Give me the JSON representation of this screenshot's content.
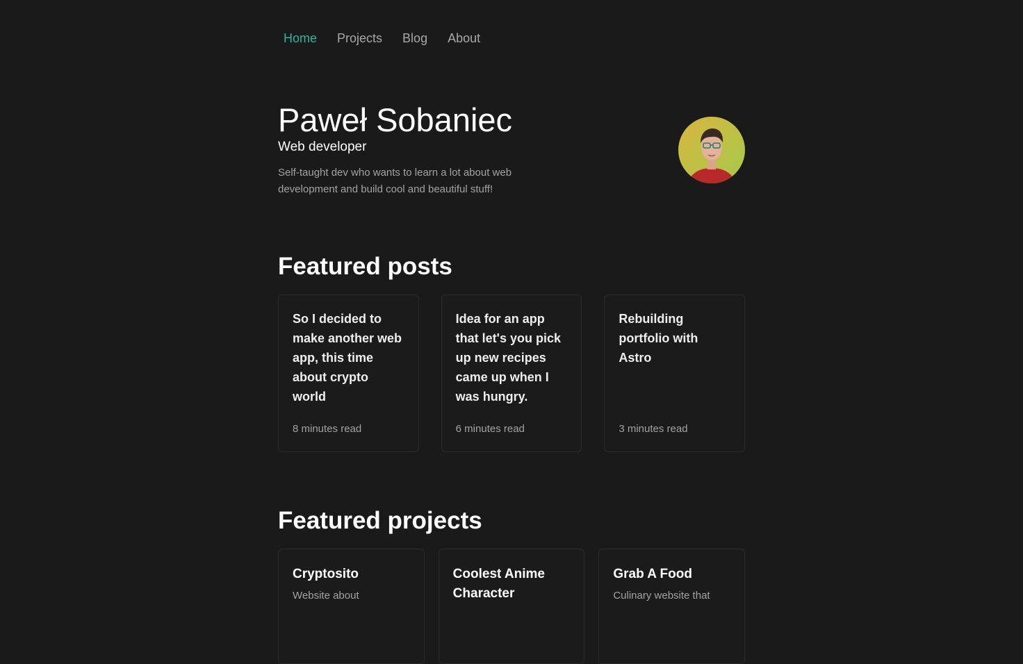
{
  "nav": {
    "items": [
      {
        "label": "Home",
        "active": true
      },
      {
        "label": "Projects",
        "active": false
      },
      {
        "label": "Blog",
        "active": false
      },
      {
        "label": "About",
        "active": false
      }
    ]
  },
  "hero": {
    "name": "Paweł Sobaniec",
    "role": "Web developer",
    "description": "Self-taught dev who wants to learn a lot about web development and build cool and beautiful stuff!"
  },
  "featured_posts": {
    "title": "Featured posts",
    "items": [
      {
        "title": "So I decided to make another web app, this time about crypto world",
        "meta": "8 minutes read"
      },
      {
        "title": "Idea for an app that let's you pick up new recipes came up when I was hungry.",
        "meta": "6 minutes read"
      },
      {
        "title": "Rebuilding portfolio with Astro",
        "meta": "3 minutes read"
      }
    ]
  },
  "featured_projects": {
    "title": "Featured projects",
    "items": [
      {
        "title": "Cryptosito",
        "description": "Website about"
      },
      {
        "title": "Coolest Anime Character",
        "description": ""
      },
      {
        "title": "Grab A Food",
        "description": "Culinary website that"
      }
    ]
  },
  "colors": {
    "background": "#1a1a1b",
    "accent": "#2db5a0",
    "muted": "#a3a3a3"
  }
}
